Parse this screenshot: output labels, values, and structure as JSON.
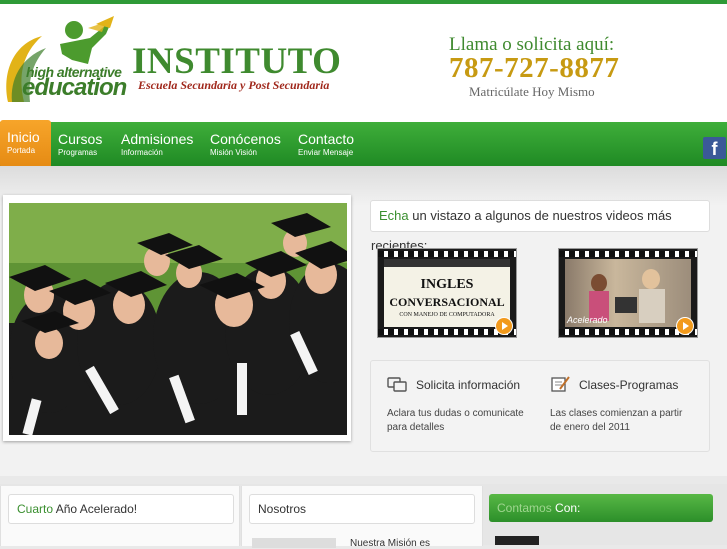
{
  "header": {
    "logo_line1": "high alternative",
    "logo_line2": "education",
    "title": "INSTITUTO",
    "subtitle": "Escuela Secundaria y Post Secundaria",
    "call_title": "Llama o solicita aquí:",
    "phone": "787-727-8877",
    "call_sub": "Matricúlate Hoy Mismo"
  },
  "nav": {
    "items": [
      {
        "label": "Inicio",
        "sub": "Portada"
      },
      {
        "label": "Cursos",
        "sub": "Programas"
      },
      {
        "label": "Admisiones",
        "sub": "Información"
      },
      {
        "label": "Conócenos",
        "sub": "Misión Visión"
      },
      {
        "label": "Contacto",
        "sub": "Enviar Mensaje"
      }
    ],
    "social_icon": "facebook-icon",
    "social_glyph": "f"
  },
  "videos": {
    "highlight": "Echa",
    "text": " un vistazo a algunos de nuestros videos más recientes:",
    "video1_line1": "INGLES",
    "video1_line2": "CONVERSACIONAL",
    "video1_line3": "CON MANEJO DE COMPUTADORA",
    "video2_label": "Acelerado"
  },
  "info": {
    "col1_title": "Solicita información",
    "col1_desc": "Aclara tus dudas o comunicate para detalles",
    "col2_title": "Clases-Programas",
    "col2_desc": "Las clases comienzan a partir de enero del 2011"
  },
  "lower": {
    "box1_highlight": "Cuarto",
    "box1_text": " Año Acelerado!",
    "box2_title": "Nosotros",
    "box2_preview": "Nuestra Misión es",
    "box3_highlight": "Contamos",
    "box3_text": " Con:"
  },
  "colors": {
    "brand_green": "#3f8a2f",
    "nav_green": "#2f9c30",
    "nav_active": "#f29a1c",
    "phone_gold": "#c79a12"
  }
}
